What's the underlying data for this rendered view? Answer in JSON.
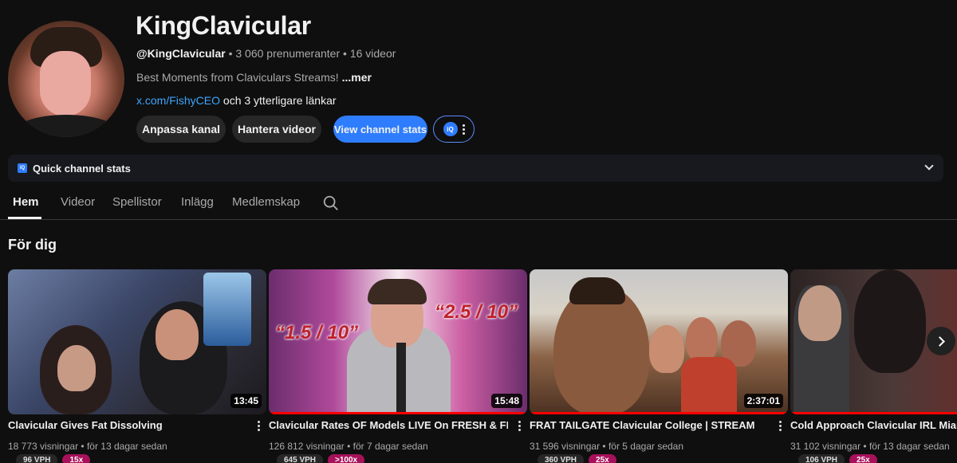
{
  "channel": {
    "name": "KingClavicular",
    "handle": "@KingClavicular",
    "subscribers": "3 060 prenumeranter",
    "video_count": "16 videor",
    "description": "Best Moments from Claviculars Streams!",
    "more_label": "...mer",
    "link_url": "x.com/FishyCEO",
    "link_suffix": "och 3 ytterligare länkar"
  },
  "buttons": {
    "customize": "Anpassa kanal",
    "manage": "Hantera videor",
    "stats": "View channel stats",
    "iq_badge": "iQ"
  },
  "quick_stats": {
    "label": "Quick channel stats",
    "icon": "iQ"
  },
  "tabs": [
    "Hem",
    "Videor",
    "Spellistor",
    "Inlägg",
    "Medlemskap"
  ],
  "section": {
    "title": "För dig"
  },
  "thumbnail_text": {
    "v2_left": "“1.5 / 10”",
    "v2_right": "“2.5 / 10”"
  },
  "videos": [
    {
      "title": "Clavicular Gives Fat Dissolving",
      "views": "18 773 visningar",
      "age": "för 13 dagar sedan",
      "duration": "13:45",
      "vph": "96 VPH",
      "multiplier": "15x",
      "progress": 0
    },
    {
      "title": "Clavicular Rates OF Models LIVE On FRESH & FIT",
      "views": "126 812 visningar",
      "age": "för 7 dagar sedan",
      "duration": "15:48",
      "vph": "645 VPH",
      "multiplier": ">100x",
      "progress": 1.0
    },
    {
      "title": "FRAT TAILGATE Clavicular College | STREAM",
      "views": "31 596 visningar",
      "age": "för 5 dagar sedan",
      "duration": "2:37:01",
      "vph": "360 VPH",
      "multiplier": "25x",
      "progress": 1.0
    },
    {
      "title": "Cold Approach Clavicular IRL Miami",
      "views": "31 102 visningar",
      "age": "för 13 dagar sedan",
      "duration": "",
      "vph": "106 VPH",
      "multiplier": "25x",
      "progress": 1.0
    }
  ],
  "colors": {
    "background": "#0f0f0f",
    "accent_blue": "#2f7dff",
    "link_blue": "#3ea6ff",
    "multiplier_pink": "#a6115a",
    "progress_red": "#ff0000"
  },
  "icons": {
    "search": "search-icon",
    "next": "chevron-right-icon",
    "expand": "chevron-down-icon",
    "more": "more-vert-icon"
  }
}
